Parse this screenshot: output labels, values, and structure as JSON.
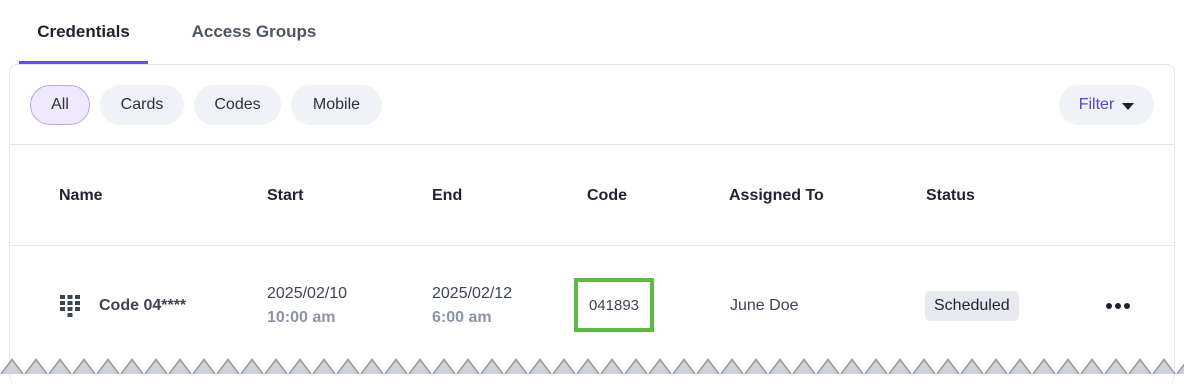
{
  "tabs": [
    {
      "label": "Credentials",
      "active": true
    },
    {
      "label": "Access Groups",
      "active": false
    }
  ],
  "filters": {
    "chips": [
      "All",
      "Cards",
      "Codes",
      "Mobile"
    ],
    "selected": "All",
    "filter_label": "Filter"
  },
  "table": {
    "headers": [
      "Name",
      "Start",
      "End",
      "Code",
      "Assigned To",
      "Status"
    ],
    "rows": [
      {
        "icon": "keypad-icon",
        "name": "Code 04****",
        "start_date": "2025/02/10",
        "start_time": "10:00 am",
        "end_date": "2025/02/12",
        "end_time": "6:00 am",
        "code": "041893",
        "assigned_to": "June Doe",
        "status": "Scheduled"
      }
    ]
  },
  "colors": {
    "accent": "#6c4de6",
    "filter_text": "#5b3fd6",
    "highlight_border": "#5cbb42"
  }
}
